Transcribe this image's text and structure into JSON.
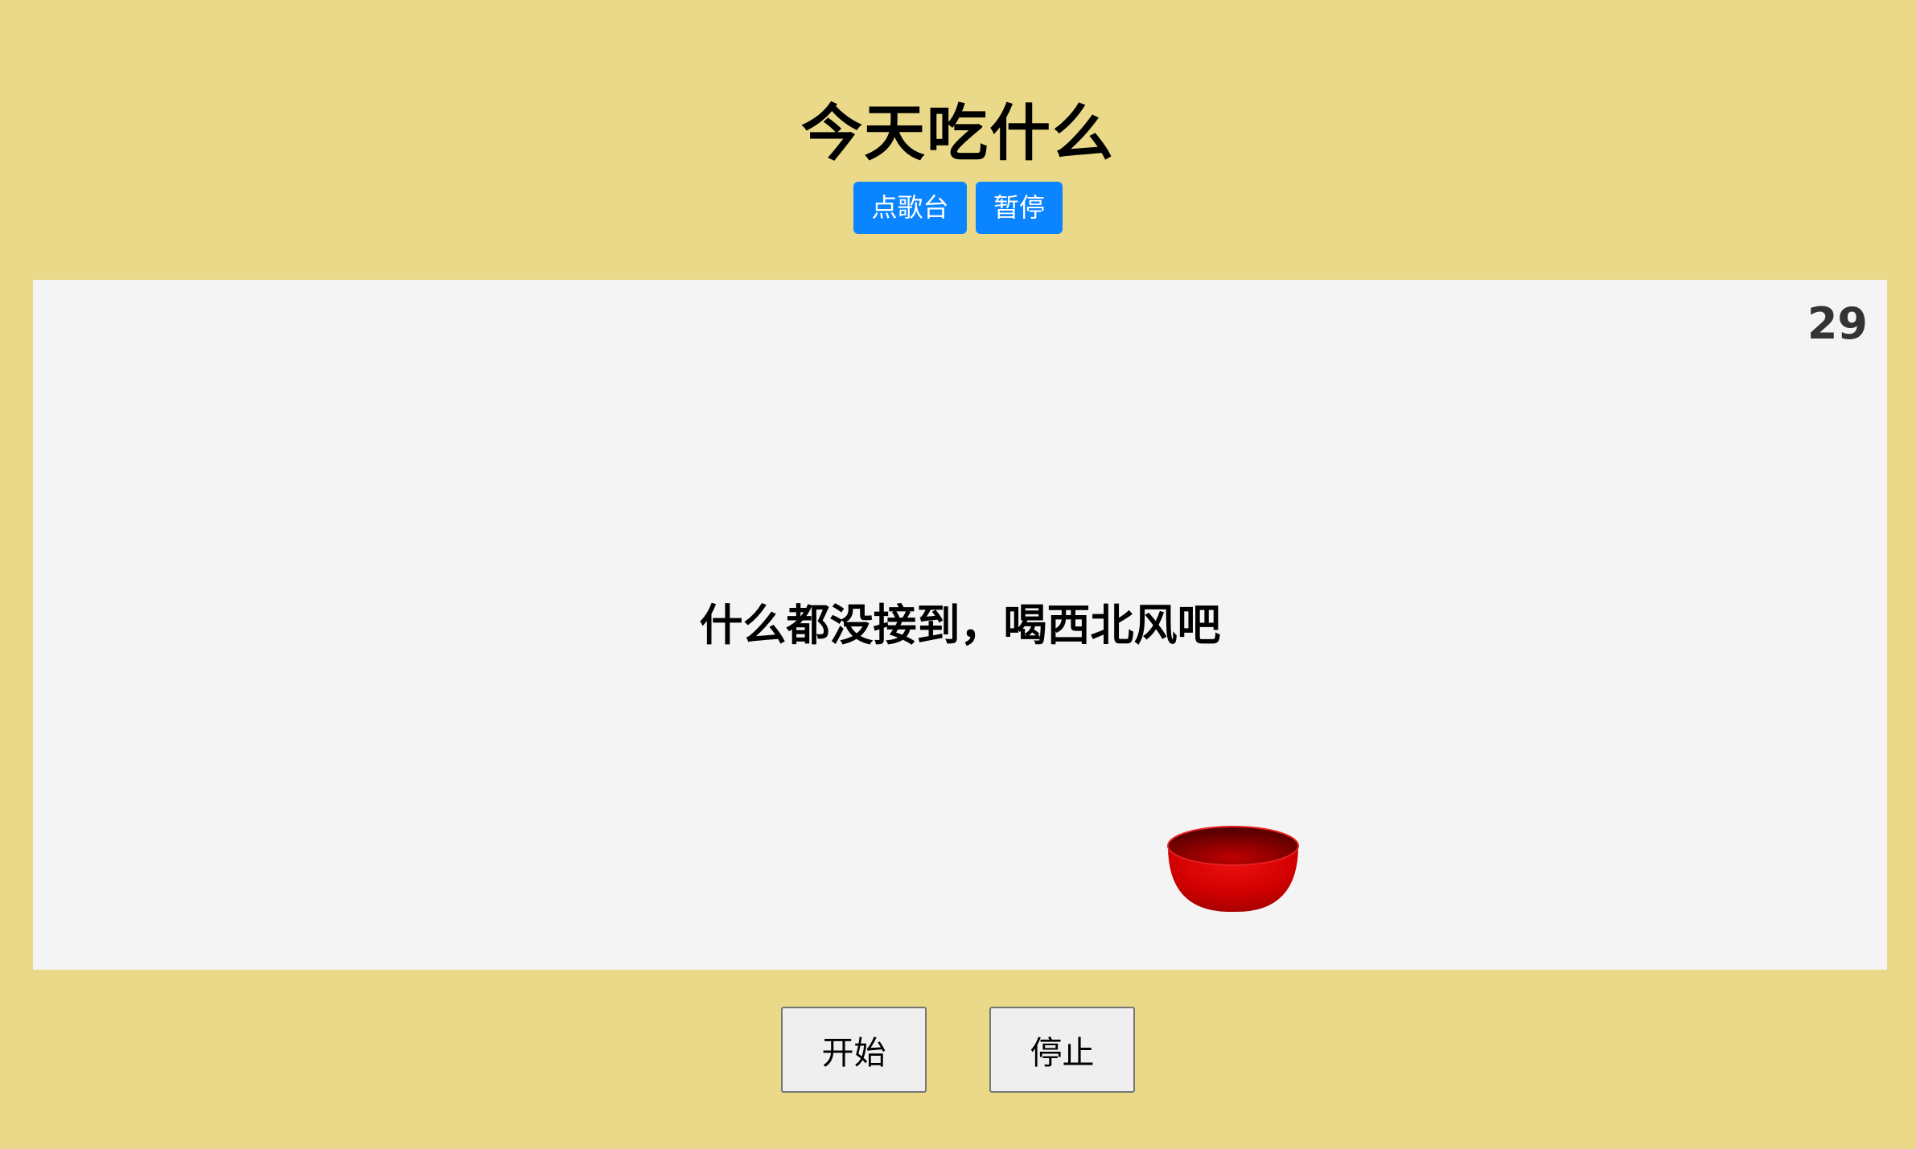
{
  "header": {
    "title": "今天吃什么"
  },
  "toolbar": {
    "playlist_label": "点歌台",
    "pause_label": "暂停"
  },
  "game": {
    "score": "29",
    "message": "什么都没接到，喝西北风吧",
    "catcher_icon": "bowl-icon",
    "catcher_color": "#d10000"
  },
  "controls": {
    "start_label": "开始",
    "stop_label": "停止"
  },
  "colors": {
    "page_background": "#e9d988",
    "game_background": "#f4f4f4",
    "accent_button": "#0a84ff"
  }
}
